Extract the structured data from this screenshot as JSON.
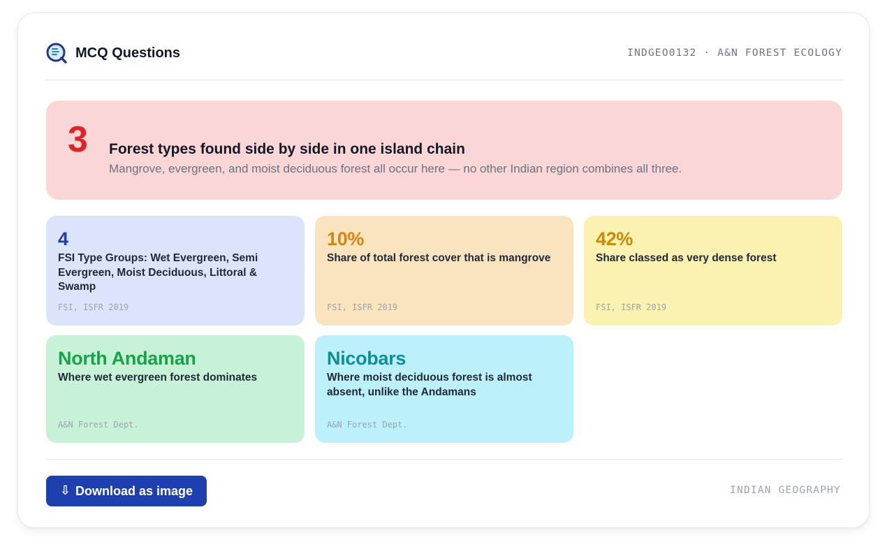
{
  "header": {
    "logo_icon": "quiz-search-logo-icon",
    "title": "MCQ Questions",
    "code": "INDGEO0132 · A&N FOREST ECOLOGY"
  },
  "hero": {
    "value": "3",
    "title": "Forest types found side by side in one island chain",
    "description": "Mangrove, evergreen, and moist deciduous forest all occur here — no other Indian region combines all three."
  },
  "stats": [
    {
      "value": "4",
      "label": "FSI Type Groups: Wet Evergreen, Semi Evergreen, Moist Deciduous, Littoral & Swamp",
      "source": "FSI, ISFR 2019",
      "color": "#1e40af"
    },
    {
      "value": "10%",
      "label": "Share of total forest cover that is mangrove",
      "source": "FSI, ISFR 2019",
      "color": "#d38712"
    },
    {
      "value": "42%",
      "label": "Share classed as very dense forest",
      "source": "FSI, ISFR 2019",
      "color": "#c88a0b"
    },
    {
      "value": "North Andaman",
      "label": "Where wet evergreen forest dominates",
      "source": "A&N Forest Dept.",
      "color": "#16a34a"
    },
    {
      "value": "Nicobars",
      "label": "Where moist deciduous forest is almost absent, unlike the Andamans",
      "source": "A&N Forest Dept.",
      "color": "#0e8f97"
    }
  ],
  "footer": {
    "download_icon": "download-arrow-icon",
    "download_label": "Download as image",
    "tag": "INDIAN GEOGRAPHY"
  },
  "colors": {
    "accent": "#1e40af",
    "hero_bg": "#fad6d6",
    "hero_value": "#dc2626"
  }
}
